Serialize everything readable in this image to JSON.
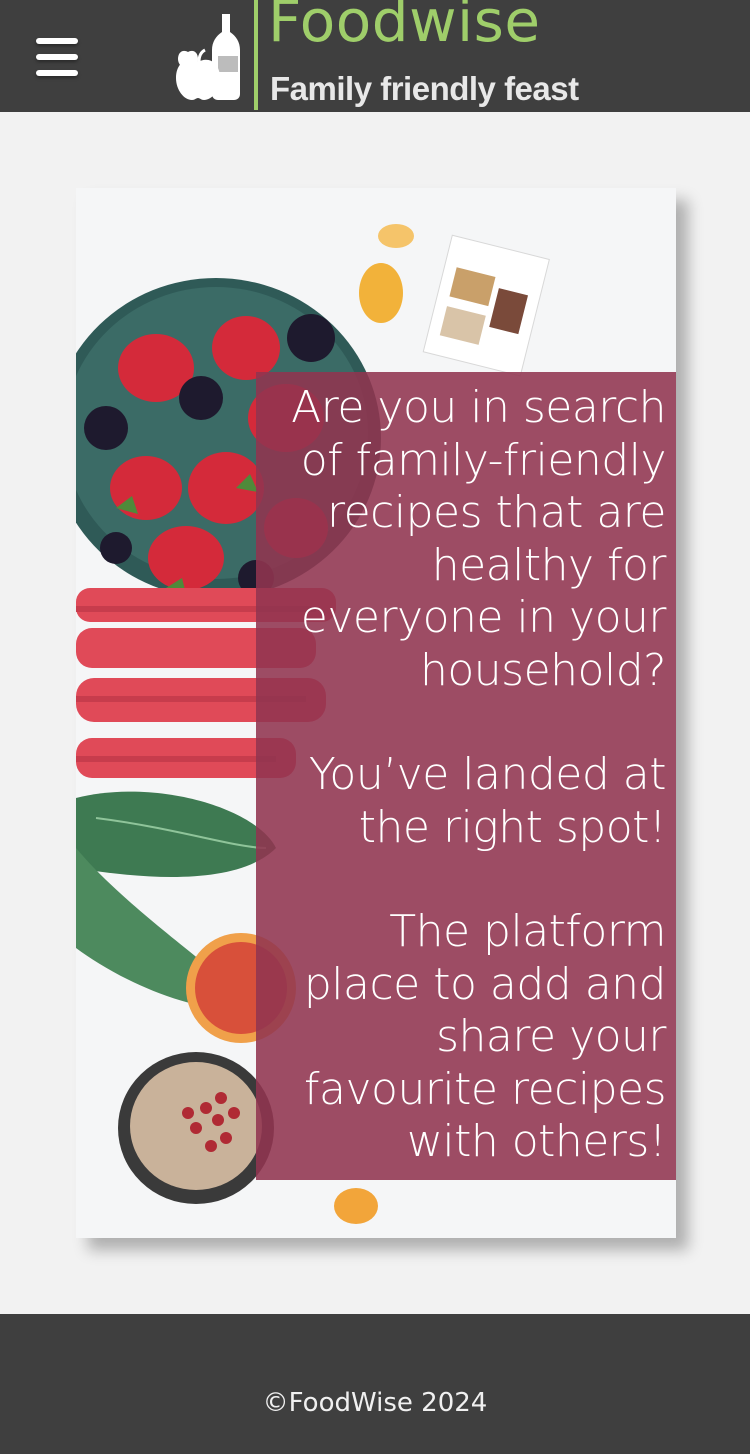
{
  "header": {
    "menu_icon": "hamburger-menu-icon",
    "logo": {
      "title": "Foodwise",
      "tagline": "Family friendly feast",
      "mark_icon": "apple-and-bottle-icon",
      "colors": {
        "title": "#9fce6a",
        "tagline": "#e8e8e8"
      }
    },
    "background": "#3f3f3f"
  },
  "hero": {
    "image_icon": "fruit-and-vegetables-photo",
    "paragraphs": [
      "Are you in search of family-friendly recipes that are healthy for everyone in your household?",
      "You’ve landed at the right spot!",
      "The platform place to add and share your favourite recipes with others!"
    ],
    "overlay_color": "#913450"
  },
  "footer": {
    "copyright": "©FoodWise 2024",
    "background": "#3f3f3f"
  }
}
